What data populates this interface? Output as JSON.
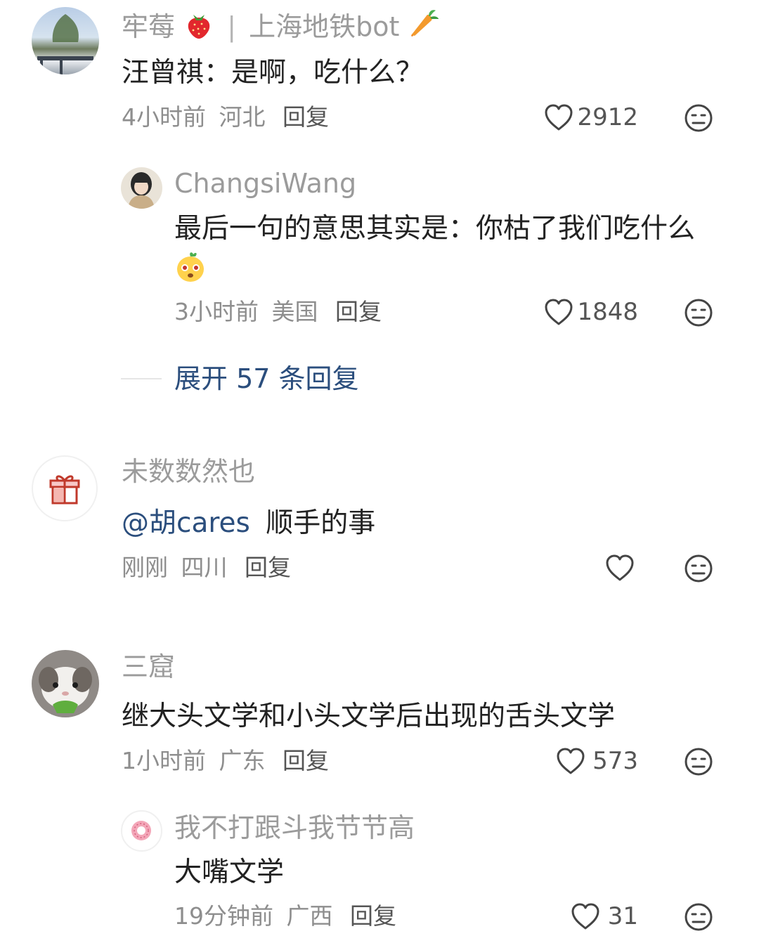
{
  "comments": [
    {
      "name": "牢莓",
      "badge": "上海地铁bot",
      "text": "汪曾祺：是啊，吃什么？",
      "time": "4小时前",
      "location": "河北",
      "reply": "回复",
      "likes": "2912",
      "reply_item": {
        "name": "ChangsiWang",
        "text": "最后一句的意思其实是：你枯了我们吃什么",
        "time": "3小时前",
        "location": "美国",
        "reply": "回复",
        "likes": "1848"
      },
      "expand_label": "展开 57 条回复"
    },
    {
      "name": "未数数然也",
      "mention": "@胡cares",
      "text": "顺手的事",
      "time": "刚刚",
      "location": "四川",
      "reply": "回复",
      "likes": ""
    },
    {
      "name": "三窟",
      "text": "继大头文学和小头文学后出现的舌头文学",
      "time": "1小时前",
      "location": "广东",
      "reply": "回复",
      "likes": "573",
      "reply_item": {
        "name": "我不打跟斗我节节高",
        "text": "大嘴文学",
        "time": "19分钟前",
        "location": "广西",
        "reply": "回复",
        "likes": "31"
      }
    }
  ],
  "colors": {
    "name": "#9b9b9b",
    "text": "#222222",
    "mention": "#2b4e7d",
    "meta": "#8e8e8e",
    "expand": "#2b4e7d"
  },
  "icons": [
    "heart-outline-icon",
    "meh-face-icon",
    "strawberry-icon",
    "carrot-icon",
    "gift-icon",
    "emoji-sticker-icon"
  ]
}
